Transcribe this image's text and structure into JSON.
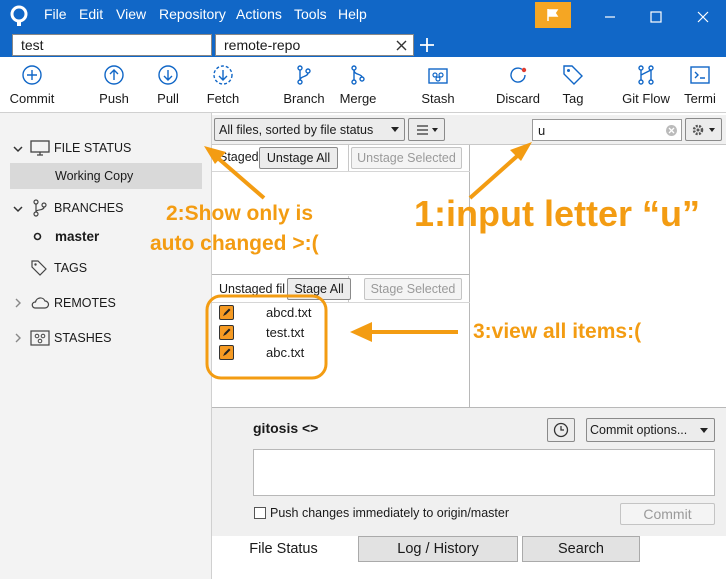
{
  "menu": {
    "file": "File",
    "edit": "Edit",
    "view": "View",
    "repository": "Repository",
    "actions": "Actions",
    "tools": "Tools",
    "help": "Help"
  },
  "tabs": [
    {
      "label": "test"
    },
    {
      "label": "remote-repo"
    }
  ],
  "toolbar": {
    "commit": "Commit",
    "push": "Push",
    "pull": "Pull",
    "fetch": "Fetch",
    "branch": "Branch",
    "merge": "Merge",
    "stash": "Stash",
    "discard": "Discard",
    "tag": "Tag",
    "gitflow": "Git Flow",
    "terminal": "Termi"
  },
  "sidebar": {
    "file_status": "FILE STATUS",
    "working_copy": "Working Copy",
    "branches": "BRANCHES",
    "master": "master",
    "tags": "TAGS",
    "remotes": "REMOTES",
    "stashes": "STASHES"
  },
  "filter": {
    "dropdown": "All files, sorted by file status",
    "search_value": "u"
  },
  "staged": {
    "label": "Staged",
    "unstage_all": "Unstage All",
    "unstage_selected": "Unstage Selected"
  },
  "unstaged": {
    "label": "Unstaged fil",
    "stage_all": "Stage All",
    "stage_selected": "Stage Selected",
    "files": [
      "abcd.txt",
      "test.txt",
      "abc.txt"
    ]
  },
  "commit": {
    "author": "gitosis <>",
    "options": "Commit options...",
    "push_label": "Push changes immediately to origin/master",
    "commit_button": "Commit"
  },
  "bottom_tabs": {
    "file_status": "File Status",
    "log_history": "Log / History",
    "search": "Search"
  },
  "annotations": {
    "a1": "1:input letter “u”",
    "a2_line1": "2:Show only is",
    "a2_line2": "auto changed >:(",
    "a3": "3:view all items:("
  },
  "colors": {
    "titlebar": "#1167c7",
    "accent": "#f39c12",
    "flag": "#f5a623"
  }
}
